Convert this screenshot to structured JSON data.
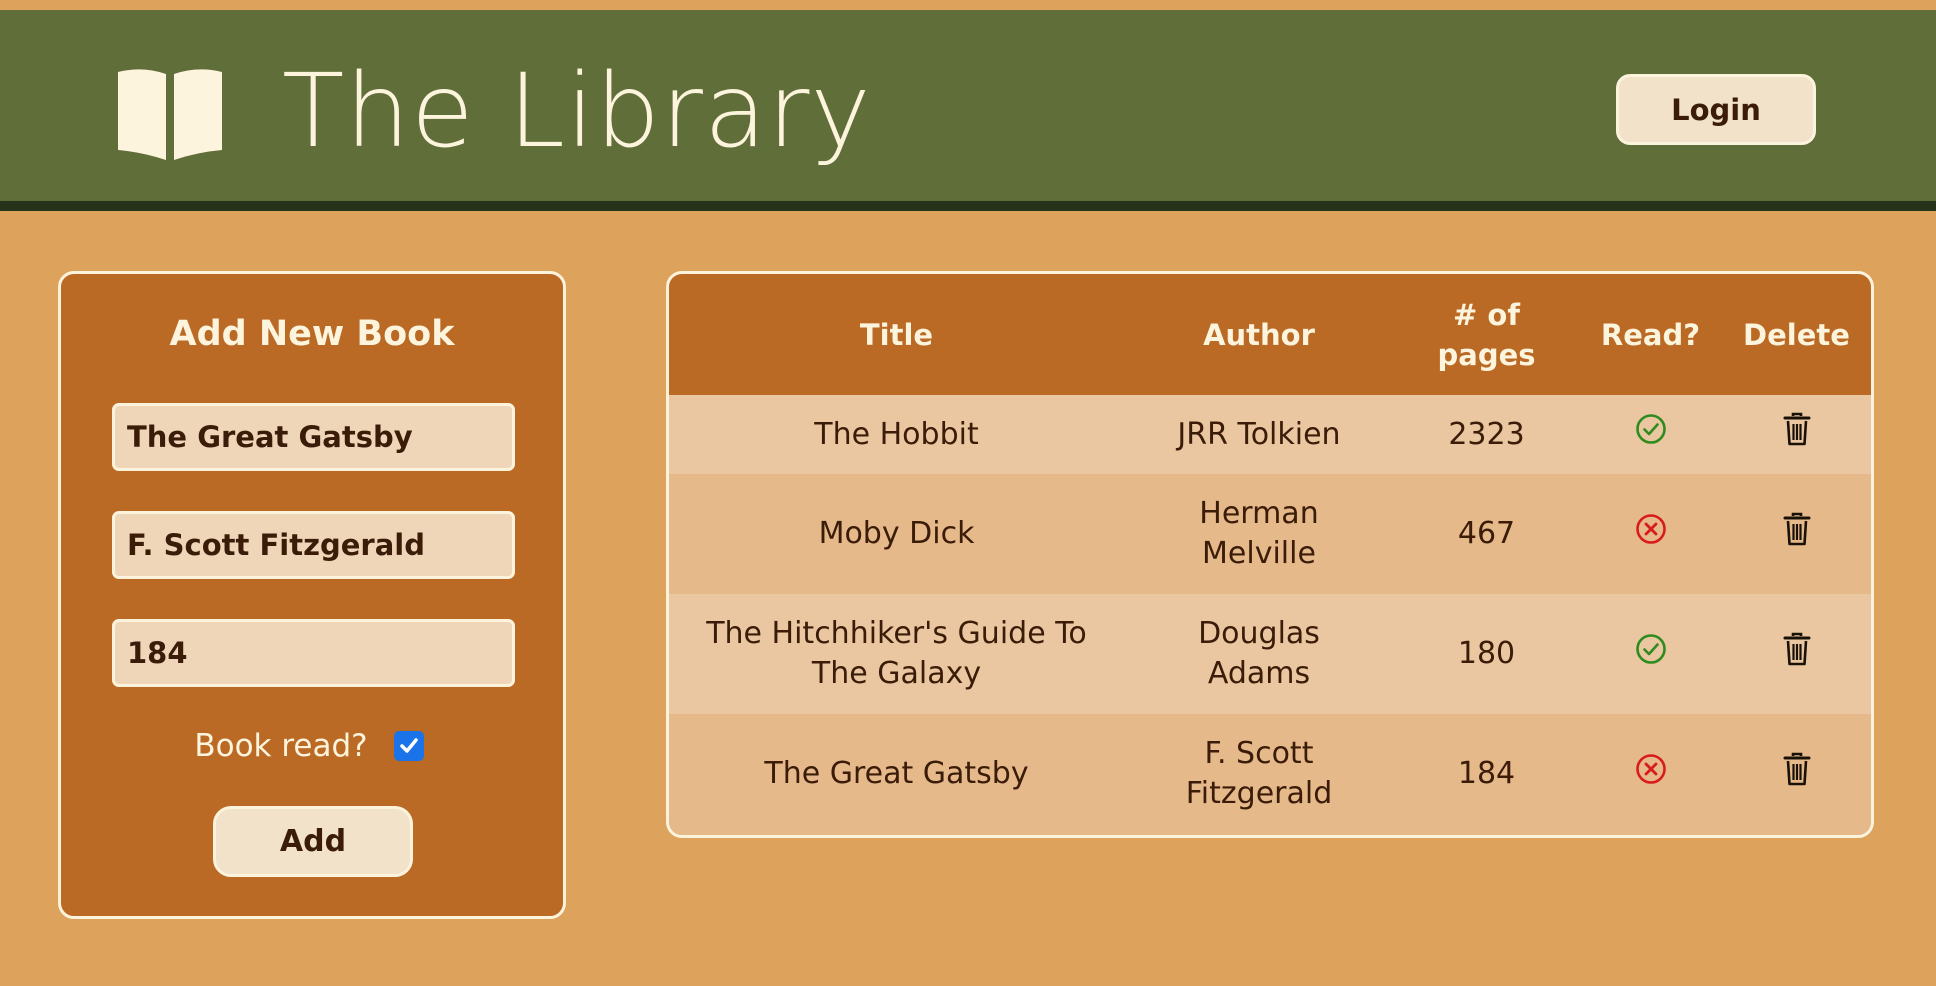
{
  "header": {
    "title": "The Library",
    "logo_icon": "open-book-icon",
    "login_label": "Login"
  },
  "form": {
    "title": "Add New Book",
    "title_value": "The Great Gatsby",
    "author_value": "F. Scott Fitzgerald",
    "pages_value": "184",
    "read_label": "Book read?",
    "read_checked": true,
    "add_label": "Add"
  },
  "table": {
    "headers": [
      "Title",
      "Author",
      "# of pages",
      "Read?",
      "Delete"
    ],
    "rows": [
      {
        "title": "The Hobbit",
        "author": "JRR Tolkien",
        "pages": "2323",
        "read": true
      },
      {
        "title": "Moby Dick",
        "author": "Herman Melville",
        "pages": "467",
        "read": false
      },
      {
        "title": "The Hitchhiker's Guide To The Galaxy",
        "author": "Douglas Adams",
        "pages": "180",
        "read": true
      },
      {
        "title": "The Great Gatsby",
        "author": "F. Scott Fitzgerald",
        "pages": "184",
        "read": false
      }
    ]
  },
  "colors": {
    "header_bg": "#606e3a",
    "page_bg": "#dda25c",
    "panel_bg": "#bb6a25",
    "read_yes": "#2e8b1e",
    "read_no": "#d81b1b"
  }
}
